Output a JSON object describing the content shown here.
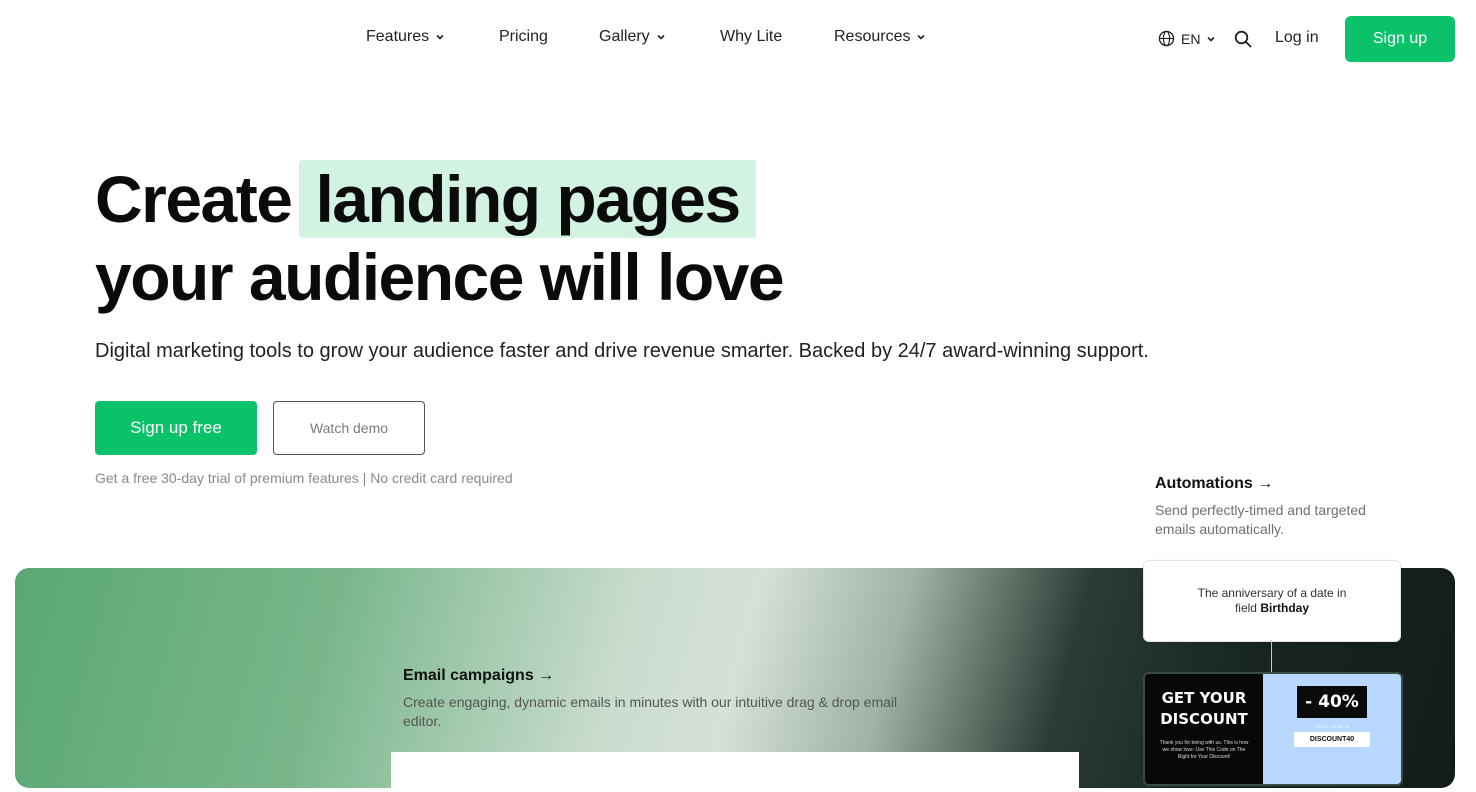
{
  "nav": {
    "items": [
      {
        "label": "Features",
        "dropdown": true
      },
      {
        "label": "Pricing",
        "dropdown": false
      },
      {
        "label": "Gallery",
        "dropdown": true
      },
      {
        "label": "Why Lite",
        "dropdown": false
      },
      {
        "label": "Resources",
        "dropdown": true
      }
    ],
    "language": "EN",
    "login_label": "Log in",
    "signup_label": "Sign up"
  },
  "hero": {
    "title_part1": "Create",
    "title_highlight": "landing pages",
    "title_line2": "your audience will love",
    "subtitle": "Digital marketing tools to grow your audience faster and drive revenue smarter. Backed by 24/7 award-winning support.",
    "cta_primary": "Sign up free",
    "cta_secondary": "Watch demo",
    "trial_note": "Get a free 30-day trial of premium features | No credit card required"
  },
  "automations": {
    "title": "Automations →",
    "desc": "Send perfectly-timed and targeted emails automatically.",
    "trigger_text": "The anniversary of a date in",
    "trigger_field_prefix": "field",
    "trigger_field": "Birthday"
  },
  "email_campaigns": {
    "title": "Email campaigns →",
    "desc": "Create engaging, dynamic emails in minutes with our intuitive drag & drop email editor."
  },
  "coupon": {
    "headline": "GET YOUR DISCOUNT",
    "body": "Thank you for being with us. This is how we show love: Use This Code on The Right for Your Discount!",
    "percent": "- 40%",
    "code_label": "YOUR CODE IS",
    "code": "DISCOUNT40"
  },
  "colors": {
    "brand_green": "#09c269",
    "highlight": "#d2f3e1"
  }
}
